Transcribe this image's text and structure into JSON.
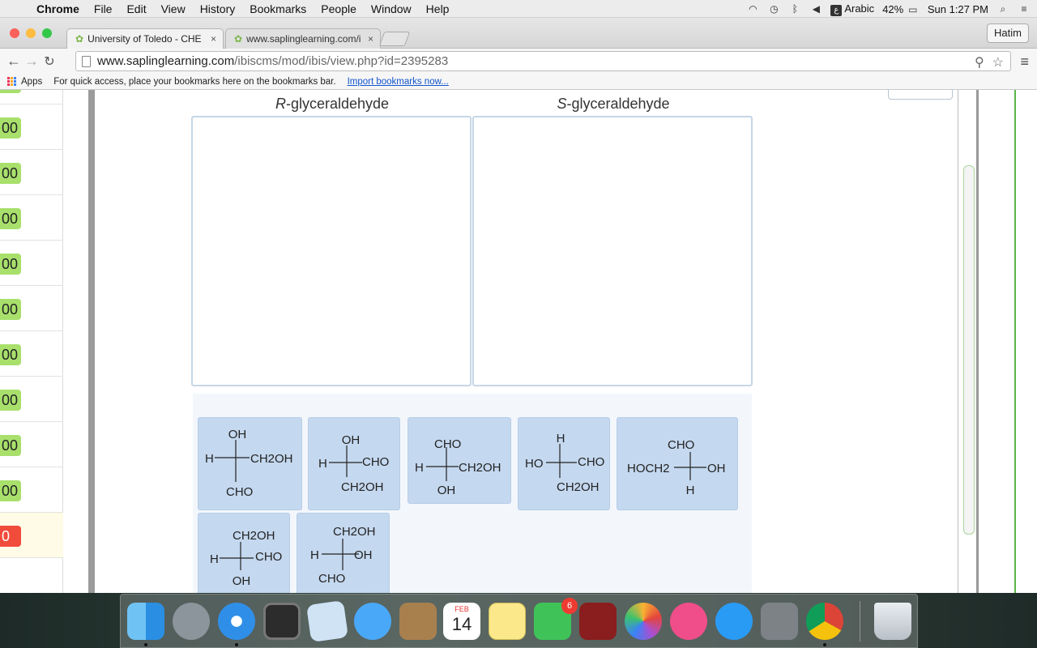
{
  "menubar": {
    "app": "Chrome",
    "items": [
      "File",
      "Edit",
      "View",
      "History",
      "Bookmarks",
      "People",
      "Window",
      "Help"
    ],
    "input_source": "Arabic",
    "battery": "42%",
    "clock": "Sun 1:27 PM"
  },
  "browser": {
    "tabs": [
      {
        "title": "University of Toledo - CHE"
      },
      {
        "title": "www.saplinglearning.com/i"
      }
    ],
    "profile": "Hatim",
    "url_domain": "www.saplinglearning.com",
    "url_path": "/ibiscms/mod/ibis/view.php?id=2395283",
    "bookmarks": {
      "apps_label": "Apps",
      "hint": "For quick access, place your bookmarks here on the bookmarks bar.",
      "import_link": "Import bookmarks now..."
    }
  },
  "scores": [
    "00",
    "00",
    "00",
    "00",
    "00",
    "00",
    "00",
    "00",
    "00",
    "00",
    "0"
  ],
  "question": {
    "column_titles": [
      {
        "prefix": "R",
        "suffix": "-glyceraldehyde"
      },
      {
        "prefix": "S",
        "suffix": "-glyceraldehyde"
      }
    ],
    "tiles": [
      {
        "top": "OH",
        "left": "H",
        "right": "CH2OH",
        "bottom": "CHO"
      },
      {
        "top": "OH",
        "left": "H",
        "right": "CHO",
        "bottom": "CH2OH"
      },
      {
        "top": "CHO",
        "left": "H",
        "right": "CH2OH",
        "bottom": "OH"
      },
      {
        "top": "H",
        "left": "HO",
        "right": "CHO",
        "bottom": "CH2OH"
      },
      {
        "top": "CHO",
        "left": "HOCH2",
        "right": "OH",
        "bottom": "H"
      },
      {
        "top": "CH2OH",
        "left": "H",
        "right": "CHO",
        "bottom": "OH"
      },
      {
        "top": "CH2OH",
        "left": "H",
        "right": "OH",
        "bottom": "CHO"
      }
    ]
  },
  "dock": {
    "apps": [
      "Finder",
      "Launchpad",
      "Safari",
      "Mission Control",
      "Preview",
      "Messages",
      "Contacts",
      "Calendar",
      "Notes",
      "FaceTime",
      "Photo Booth",
      "Photos",
      "iTunes",
      "App Store",
      "System Preferences",
      "Chrome",
      "Trash"
    ],
    "calendar_month": "FEB",
    "calendar_day": "14",
    "facetime_badge": "6"
  }
}
